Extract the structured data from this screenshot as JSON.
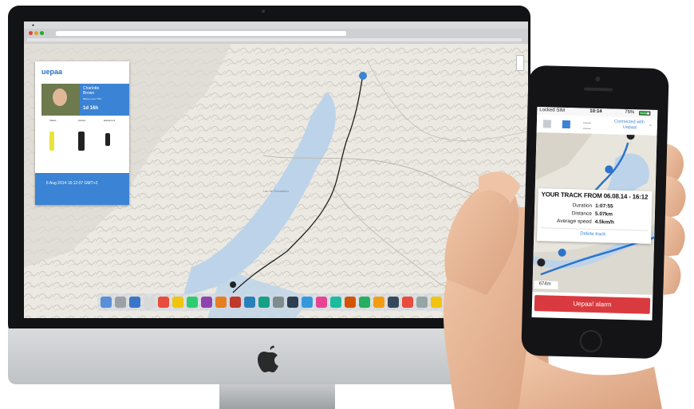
{
  "desktop": {
    "map_labels": [
      "Lac de Monastero"
    ],
    "panel": {
      "brand": "uepaa",
      "user_name_line1": "Charlotte",
      "user_name_line2": "Brown",
      "battery": "Battery level 75%",
      "last_connection": "1d 16h",
      "section_labels": [
        "Status",
        "Activity",
        "Equipment"
      ],
      "date_line": "6 Aug 2014 16:12:07 GMT+2"
    }
  },
  "phone": {
    "status": {
      "carrier": "Locked SIM",
      "time": "10:14",
      "battery": "75%"
    },
    "connected_label_1": "Connected with",
    "connected_label_2": "Uepaa!",
    "track": {
      "title": "YOUR TRACK FROM 06.08.14 - 16:12",
      "rows": [
        {
          "label": "Duration",
          "value": "1:07:55"
        },
        {
          "label": "Distance",
          "value": "5.07km"
        },
        {
          "label": "Average speed",
          "value": "4.5km/h"
        }
      ],
      "delete_label": "Delete track"
    },
    "scale_label": "674m",
    "alarm_label": "Uepaa! alarm",
    "colors": {
      "accent": "#3b83d4",
      "alarm": "#d93a3f"
    }
  }
}
